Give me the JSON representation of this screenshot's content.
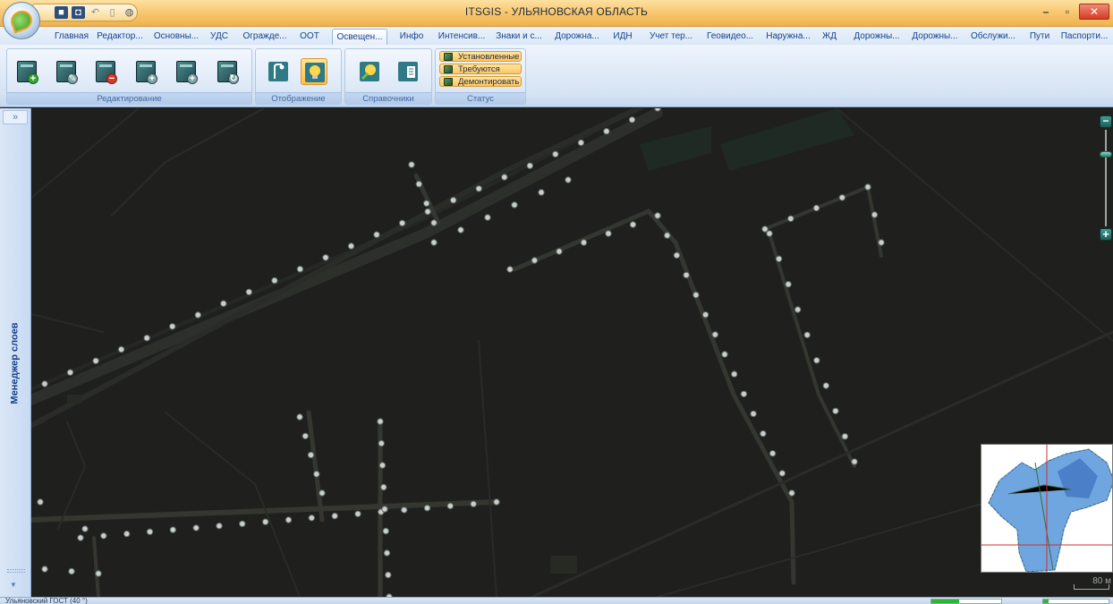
{
  "window": {
    "title": "ITSGIS - УЛЬЯНОВСКАЯ ОБЛАСТЬ",
    "controls": {
      "minimize": "–",
      "maximize": "▫",
      "close": "✕"
    }
  },
  "quick_access": [
    "save-icon",
    "disk-icon",
    "undo-icon",
    "clipboard-icon",
    "globe-icon"
  ],
  "tabs": [
    {
      "label": "Главная",
      "active": false
    },
    {
      "label": "Редактор...",
      "active": false
    },
    {
      "label": "Основны...",
      "active": false
    },
    {
      "label": "УДС",
      "active": false
    },
    {
      "label": "Огражде...",
      "active": false
    },
    {
      "label": "ООТ",
      "active": false
    },
    {
      "label": "Освещен...",
      "active": true
    },
    {
      "label": "Инфо",
      "active": false
    },
    {
      "label": "Интенсив...",
      "active": false
    },
    {
      "label": "Знаки и с...",
      "active": false
    },
    {
      "label": "Дорожна...",
      "active": false
    },
    {
      "label": "ИДН",
      "active": false
    },
    {
      "label": "Учет тер...",
      "active": false
    },
    {
      "label": "Геовидео...",
      "active": false
    },
    {
      "label": "Наружна...",
      "active": false
    },
    {
      "label": "ЖД",
      "active": false
    },
    {
      "label": "Дорожны...",
      "active": false
    },
    {
      "label": "Дорожны...",
      "active": false
    },
    {
      "label": "Обслужи...",
      "active": false
    },
    {
      "label": "Пути",
      "active": false
    },
    {
      "label": "Паспорти...",
      "active": false
    }
  ],
  "ribbon": {
    "groups": [
      {
        "label": "Редактирование",
        "buttons": [
          "add-object-icon",
          "edit-object-icon",
          "delete-object-icon",
          "add-child-icon",
          "add-copy-icon",
          "refresh-object-icon"
        ]
      },
      {
        "label": "Отображение",
        "buttons": [
          "lamp-post-icon",
          "light-bulb-icon"
        ]
      },
      {
        "label": "Справочники",
        "buttons": [
          "bulb-catalog-icon",
          "document-catalog-icon"
        ]
      },
      {
        "label": "Статус",
        "buttons": [
          "Установленные",
          "Требуются",
          "Демонтировать"
        ]
      }
    ]
  },
  "left_panel": {
    "collapse": "»",
    "label": "Менеджер слоев",
    "bottom_arrow": "▼"
  },
  "map": {
    "zoom_out": "−",
    "zoom_in": "+",
    "zoom_level": 0.75,
    "scale_text": "80 м"
  },
  "status": {
    "text": "Ульяновский ГОСТ (40 °)"
  },
  "colors": {
    "map_bg": "#1f201d",
    "road": "#2b2d29",
    "lamp": "#c9cfcc",
    "overview_region": "#3b6cc6",
    "overview_cross": "#c83232"
  }
}
